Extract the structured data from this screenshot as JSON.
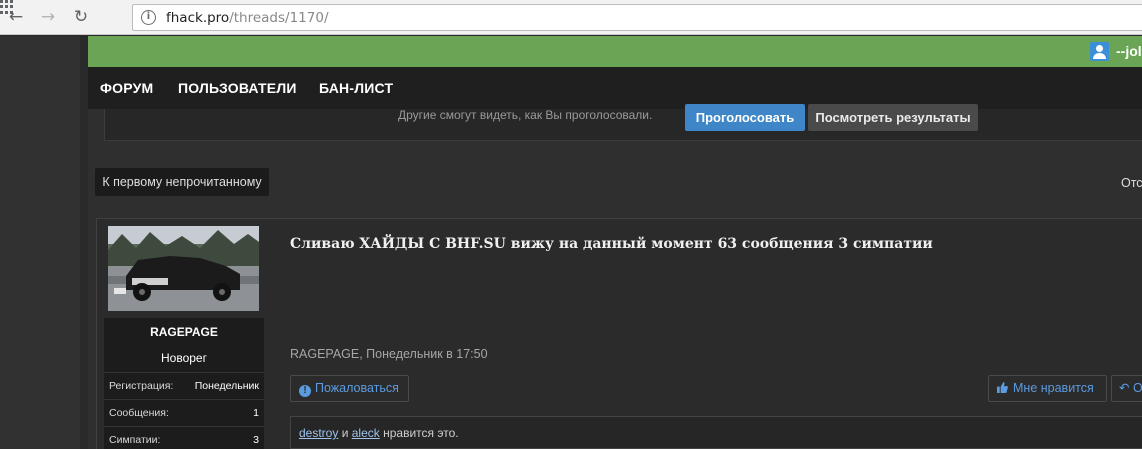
{
  "browser": {
    "url_host": "fhack.pro",
    "url_path": "/threads/1170/",
    "icons": [
      "back-icon",
      "forward-icon",
      "reload-icon",
      "apps-icon",
      "site-info-icon"
    ]
  },
  "header": {
    "username": "--jol"
  },
  "nav": {
    "items": [
      "ФОРУМ",
      "ПОЛЬЗОВАТЕЛИ",
      "БАН-ЛИСТ"
    ]
  },
  "poll": {
    "note": "Другие смогут видеть, как Вы проголосовали.",
    "vote_label": "Проголосовать",
    "results_label": "Посмотреть результаты"
  },
  "thread_controls": {
    "unread_label": "К первому непрочитанному",
    "right_cut_label": "Отс"
  },
  "post": {
    "author": "RAGEPAGE",
    "user_title": "Новорег",
    "stats": [
      {
        "key": "Регистрация:",
        "value": "Понедельник"
      },
      {
        "key": "Сообщения:",
        "value": "1"
      },
      {
        "key": "Симпатии:",
        "value": "3"
      }
    ],
    "title": "Сливаю ХАЙДЫ С BHF.SU вижу на данный момент 63 сообщения 3 симпатии",
    "meta": "RAGEPAGE, Понедельник в 17:50",
    "report_label": "Пожаловаться",
    "like_label": "Мне нравится",
    "reply_label": "Ответить",
    "likes": {
      "user1": "destroy",
      "conj": "и",
      "user2": "aleck",
      "suffix": "нравится это."
    }
  },
  "colors": {
    "accent_green": "#6aa556",
    "button_blue": "#3f86c9",
    "link_blue": "#5b9be0",
    "navbar_dark": "#1f1f1f"
  }
}
